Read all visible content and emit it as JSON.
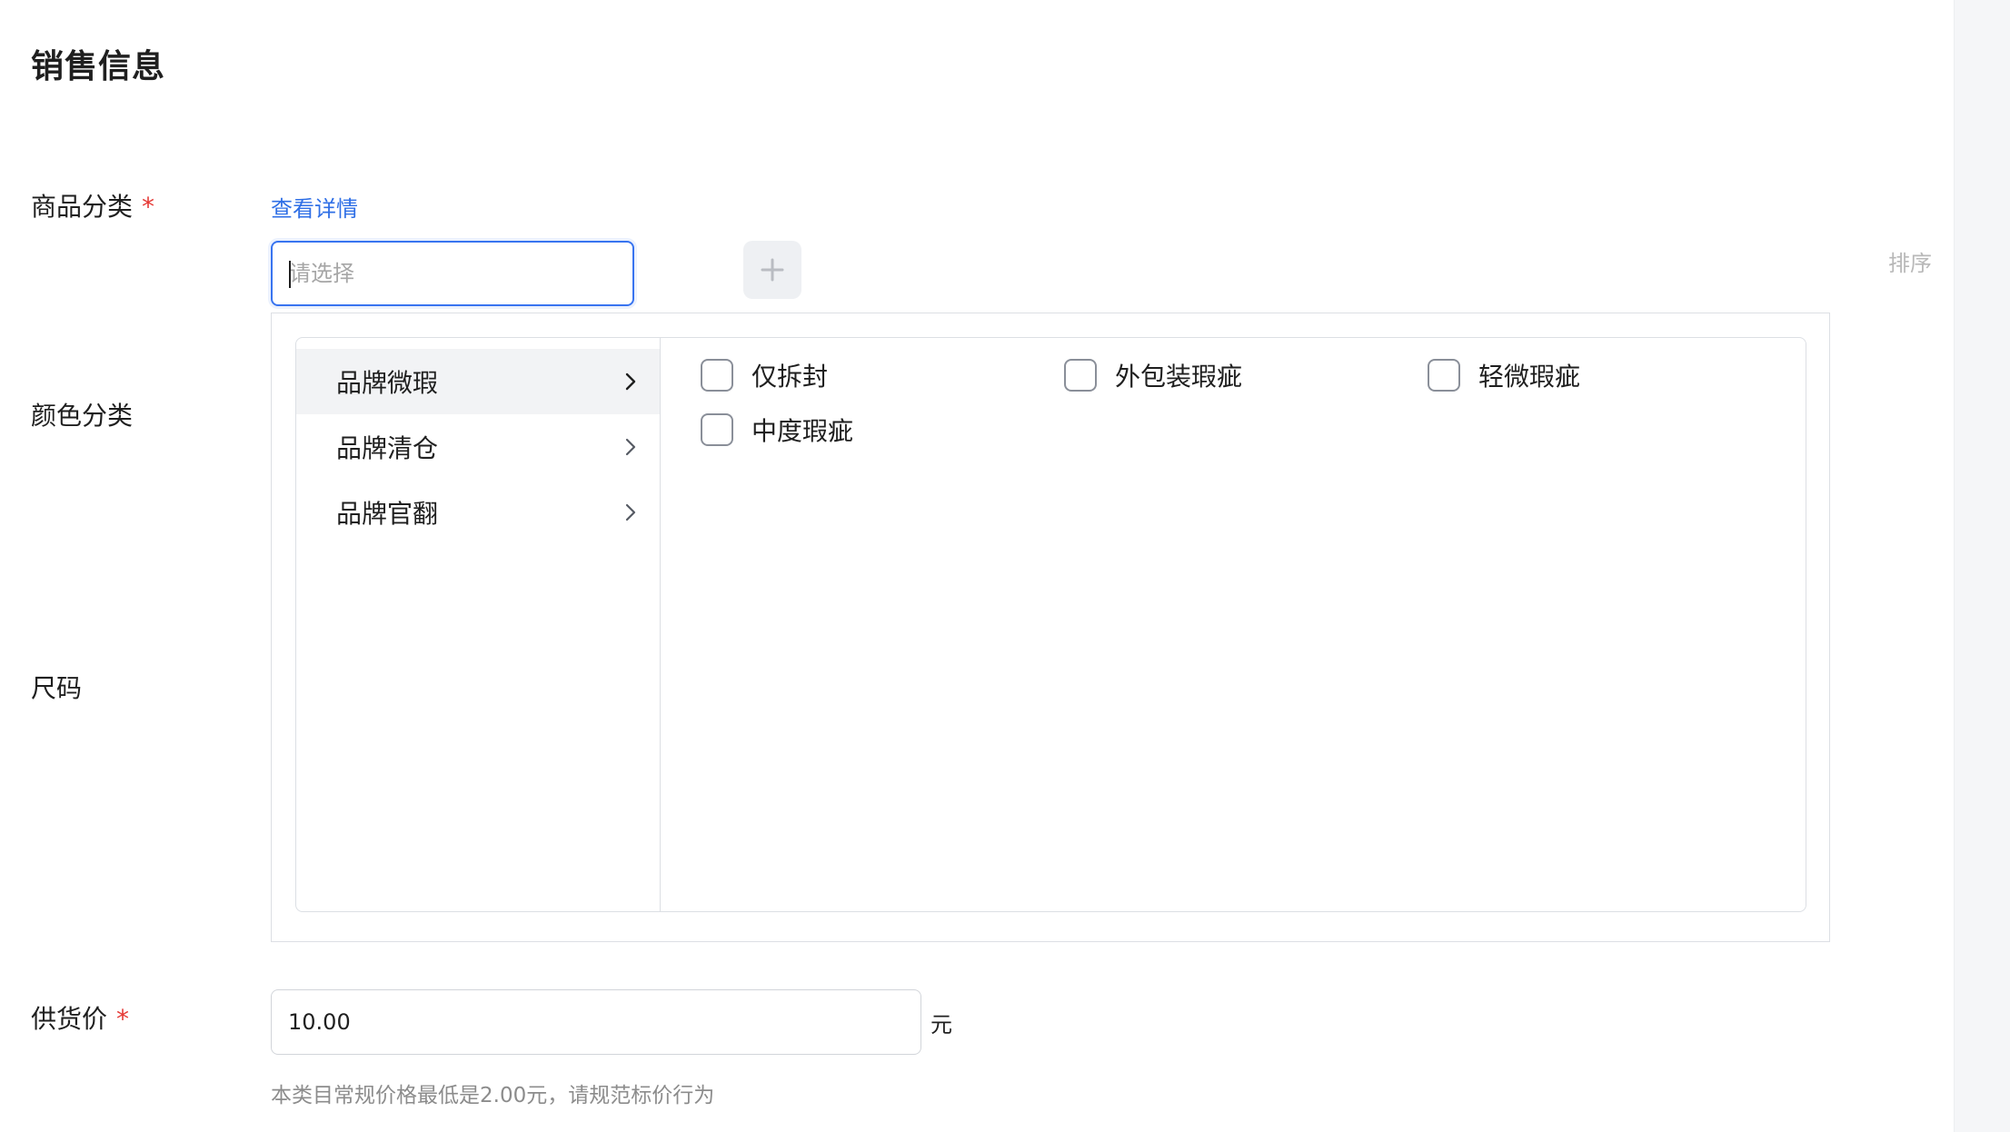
{
  "section": {
    "title": "销售信息"
  },
  "fields": {
    "category": {
      "label": "商品分类",
      "required_mark": "*",
      "detail_link": "查看详情",
      "placeholder": "请选择"
    },
    "color": {
      "label": "颜色分类"
    },
    "size": {
      "label": "尺码"
    },
    "supply_price": {
      "label": "供货价",
      "required_mark": "*",
      "value": "10.00",
      "unit": "元",
      "hint": "本类目常规价格最低是2.00元，请规范标价行为"
    }
  },
  "toolbar": {
    "add_icon": "plus-icon",
    "sort_label": "排序"
  },
  "cascader": {
    "categories": [
      {
        "label": "品牌微瑕",
        "icon": "chevron-right-icon",
        "active": true
      },
      {
        "label": "品牌清仓",
        "icon": "chevron-right-icon",
        "active": false
      },
      {
        "label": "品牌官翻",
        "icon": "chevron-right-icon",
        "active": false
      }
    ],
    "options": [
      {
        "label": "仅拆封",
        "checked": false
      },
      {
        "label": "外包装瑕疵",
        "checked": false
      },
      {
        "label": "轻微瑕疵",
        "checked": false
      },
      {
        "label": "中度瑕疵",
        "checked": false
      }
    ]
  },
  "colors": {
    "accent": "#3874f0",
    "link": "#2f6fe6",
    "required": "#e53935"
  }
}
